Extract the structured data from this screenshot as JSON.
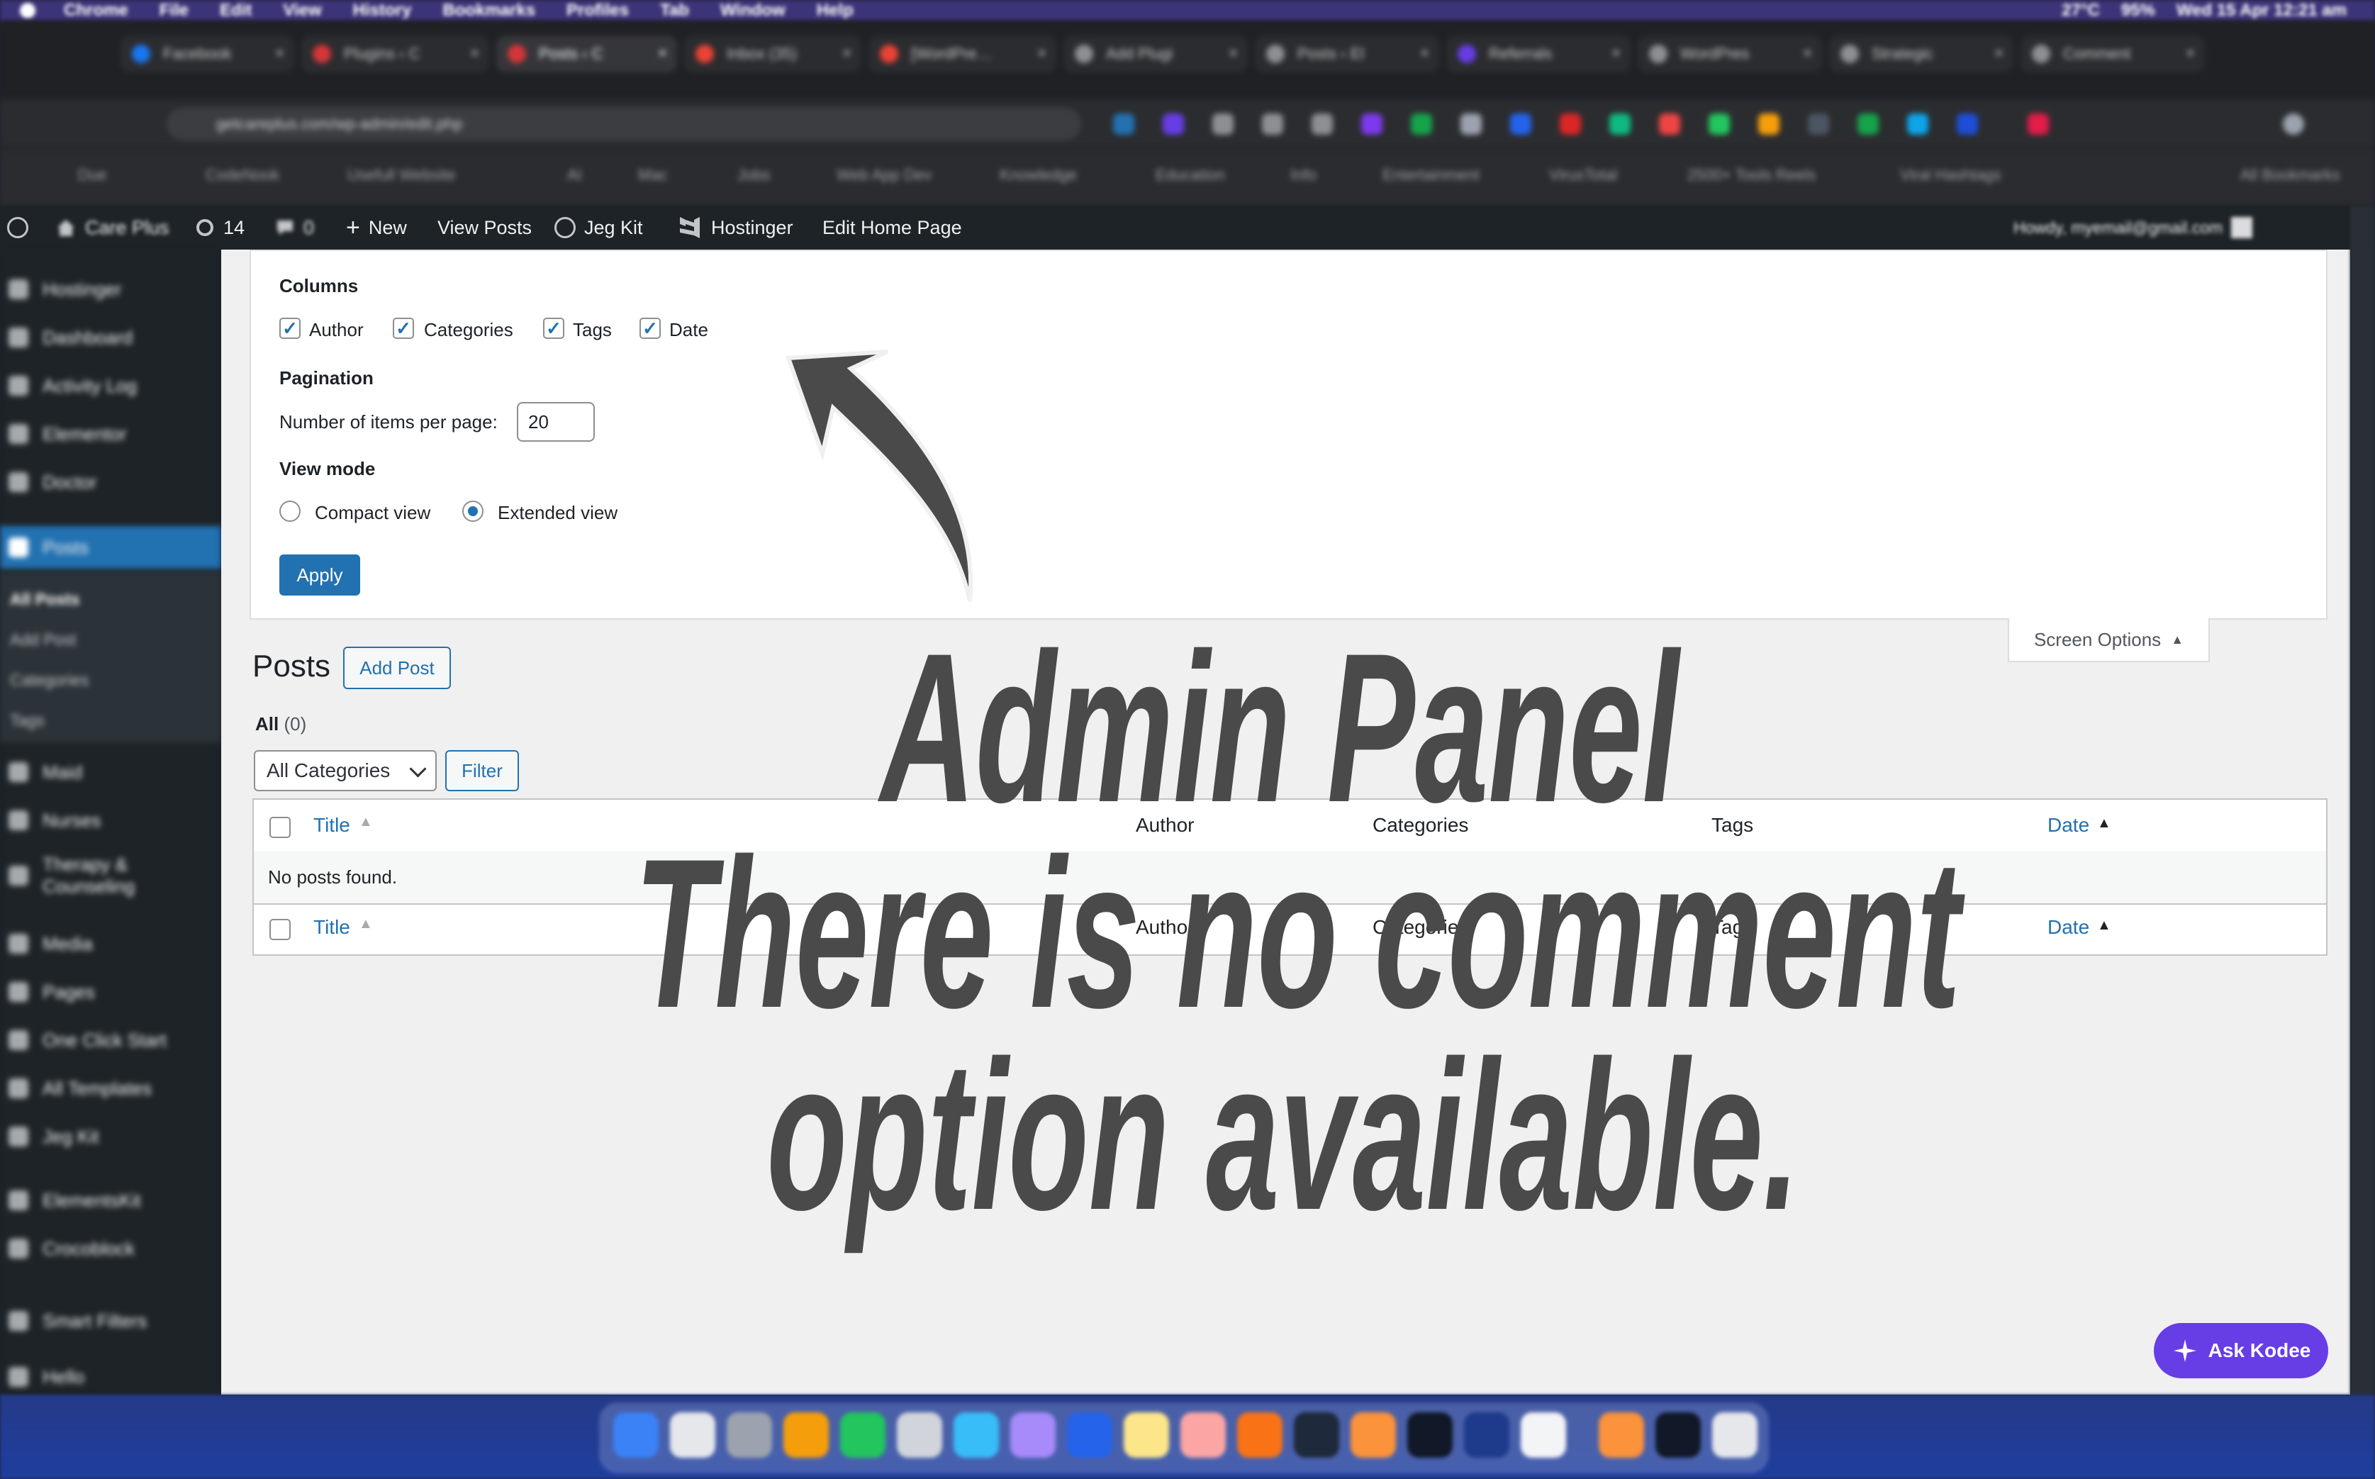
{
  "mac_menubar": {
    "app": "Chrome",
    "items": [
      "File",
      "Edit",
      "View",
      "History",
      "Bookmarks",
      "Profiles",
      "Tab",
      "Window",
      "Help"
    ],
    "status": {
      "temp": "27°C",
      "battery": "95%",
      "datetime": "Wed 15 Apr 12:21 am"
    }
  },
  "browser": {
    "tabs": [
      {
        "label": "Facebook",
        "color": "#1877f2"
      },
      {
        "label": "Plugins ‹ C",
        "color": "#d63638"
      },
      {
        "label": "Posts ‹ C",
        "color": "#d63638",
        "active": true
      },
      {
        "label": "Inbox (35)",
        "color": "#ea4335"
      },
      {
        "label": "[WordPre…",
        "color": "#ea4335"
      },
      {
        "label": "Add Plugi",
        "color": "#8c8f94"
      },
      {
        "label": "Posts ‹ El",
        "color": "#8c8f94"
      },
      {
        "label": "Referrals",
        "color": "#673de6"
      },
      {
        "label": "WordPres",
        "color": "#8c8f94"
      },
      {
        "label": "Strategic",
        "color": "#8c8f94"
      },
      {
        "label": "Comment",
        "color": "#8c8f94"
      }
    ],
    "url": "getcareplus.com/wp-admin/edit.php",
    "bookmarks": [
      "Due",
      "CodeNook",
      "Usefull Website",
      "AI",
      "Mac",
      "Jobs",
      "Web App Dev",
      "Knowledge",
      "Education",
      "Info",
      "Entertainment",
      "VirusTotal",
      "2500+ Tools Reels",
      "Viral Hashtags",
      "All Bookmarks"
    ]
  },
  "adminbar": {
    "site": "Care Plus",
    "updates": "14",
    "comments": "0",
    "new": "New",
    "view_posts": "View Posts",
    "jeg_kit": "Jeg Kit",
    "hostinger": "Hostinger",
    "edit_home": "Edit Home Page",
    "howdy": "Howdy, myemail@gmail.com"
  },
  "sidebar": {
    "items": [
      "Hostinger",
      "Dashboard",
      "Activity Log",
      "Elementor",
      "Doctor",
      "Posts",
      "Maid",
      "Nurses",
      "Therapy & Counseling",
      "Media",
      "Pages",
      "One Click Start",
      "All Templates",
      "Jeg Kit",
      "ElementsKit",
      "Crocoblock",
      "Smart Filters",
      "Hello"
    ],
    "posts_sub": [
      "All Posts",
      "Add Post",
      "Categories",
      "Tags"
    ]
  },
  "screen_options": {
    "columns_heading": "Columns",
    "columns": [
      {
        "label": "Author",
        "checked": true
      },
      {
        "label": "Categories",
        "checked": true
      },
      {
        "label": "Tags",
        "checked": true
      },
      {
        "label": "Date",
        "checked": true
      }
    ],
    "pagination_heading": "Pagination",
    "per_page_label": "Number of items per page:",
    "per_page_value": "20",
    "view_mode_heading": "View mode",
    "compact_label": "Compact view",
    "extended_label": "Extended view",
    "selected_view": "Extended view",
    "apply": "Apply",
    "tab_label": "Screen Options"
  },
  "posts": {
    "title": "Posts",
    "add_post": "Add Post",
    "filter_all": "All",
    "filter_count": "(0)",
    "category_select": "All Categories",
    "filter_button": "Filter",
    "columns": {
      "title": "Title",
      "author": "Author",
      "categories": "Categories",
      "tags": "Tags",
      "date": "Date"
    },
    "empty": "No posts found."
  },
  "overlay": {
    "line1": "Admin Panel",
    "line2": "There is no comment",
    "line3": "option available.",
    "color": "#4a4a4a"
  },
  "kodee": {
    "label": "Ask Kodee",
    "color": "#673de6"
  }
}
